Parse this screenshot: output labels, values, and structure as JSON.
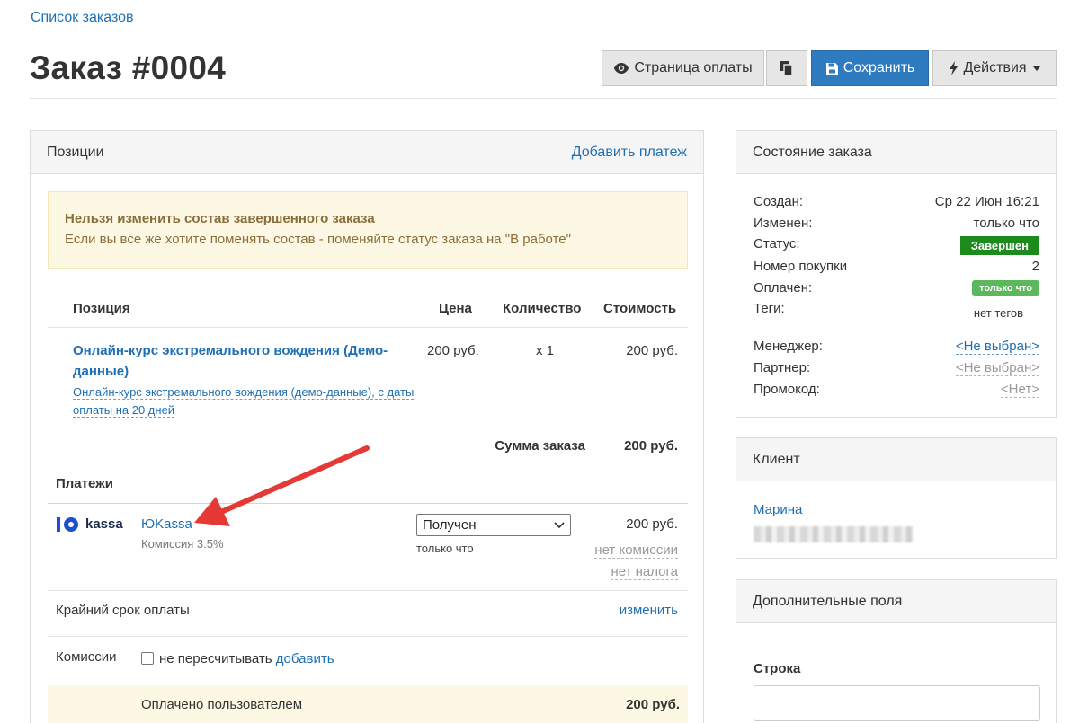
{
  "breadcrumb": "Список заказов",
  "title": "Заказ #0004",
  "toolbar": {
    "pay_page": "Страница оплаты",
    "save": "Сохранить",
    "actions": "Действия"
  },
  "positions": {
    "header": "Позиции",
    "add_payment": "Добавить платеж",
    "warning_title": "Нельзя изменить состав завершенного заказа",
    "warning_text": "Если вы все же хотите поменять состав - поменяйте статус заказа на \"В работе\"",
    "columns": {
      "item": "Позиция",
      "price": "Цена",
      "qty": "Количество",
      "cost": "Стоимость"
    },
    "item": {
      "title": "Онлайн-курс экстремального вождения (Демо-данные)",
      "subtitle": "Онлайн-курс экстремального вождения (демо-данные), с даты оплаты на 20 дней",
      "price": "200 руб.",
      "qty": "x 1",
      "cost": "200 руб."
    },
    "total_label": "Сумма заказа",
    "total_value": "200 руб."
  },
  "payments": {
    "header": "Платежи",
    "logo_text": "kassa",
    "provider": "ЮKassa",
    "commission": "Комиссия 3.5%",
    "status": "Получен",
    "status_time": "только что",
    "amount": "200 руб.",
    "no_commission": "нет комиссии",
    "no_tax": "нет налога"
  },
  "deadline": {
    "label": "Крайний срок оплаты",
    "edit": "изменить"
  },
  "commissions": {
    "label": "Комиссии",
    "no_recalc": "не пересчитывать",
    "add": "добавить"
  },
  "paid_by_user": {
    "label": "Оплачено пользователем",
    "value": "200 руб."
  },
  "order_state": {
    "header": "Состояние заказа",
    "created_label": "Создан:",
    "created_value": "Ср 22 Июн 16:21",
    "modified_label": "Изменен:",
    "modified_value": "только что",
    "status_label": "Статус:",
    "status_value": "Завершен",
    "purchase_label": "Номер покупки",
    "purchase_value": "2",
    "paid_label": "Оплачен:",
    "paid_value": "только что",
    "tags_label": "Теги:",
    "tags_value": "нет тегов",
    "manager_label": "Менеджер:",
    "manager_value": "<Не выбран>",
    "partner_label": "Партнер:",
    "partner_value": "<Не выбран>",
    "promo_label": "Промокод:",
    "promo_value": "<Нет>"
  },
  "client": {
    "header": "Клиент",
    "name": "Марина"
  },
  "extra_fields": {
    "header": "Дополнительные поля",
    "field_label": "Строка"
  },
  "colors": {
    "link": "#1f6fb2",
    "primary_button": "#2f7bc0",
    "status_done": "#1c8a1c",
    "status_paid": "#5cb85c",
    "warning_bg": "#fcf8e3",
    "annotation_arrow": "#e53935"
  }
}
